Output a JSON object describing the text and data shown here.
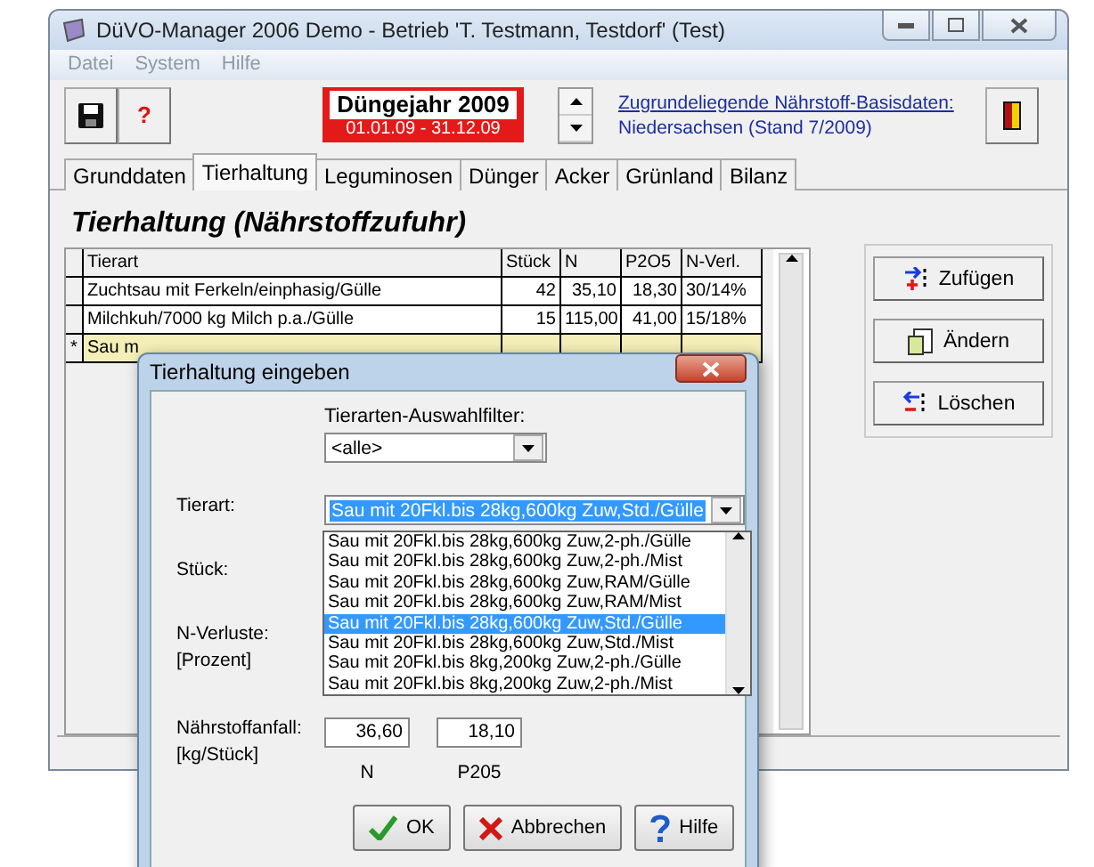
{
  "window": {
    "title": "DüVO-Manager 2006 Demo - Betrieb 'T. Testmann, Testdorf' (Test)"
  },
  "menu": [
    {
      "label": "Datei",
      "disabled": true
    },
    {
      "label": "System",
      "disabled": true
    },
    {
      "label": "Hilfe",
      "disabled": true
    }
  ],
  "toolbar": {
    "help_label": "?",
    "year_title": "Düngejahr 2009",
    "year_range": "01.01.09 - 31.12.09",
    "basis_link": "Zugrundeliegende Nährstoff-Basisdaten:",
    "basis_region": "Niedersachsen (Stand 7/2009)"
  },
  "tabs": [
    {
      "label": "Grunddaten",
      "selected": false
    },
    {
      "label": "Tierhaltung",
      "selected": true
    },
    {
      "label": "Leguminosen",
      "selected": false
    },
    {
      "label": "Dünger",
      "selected": false
    },
    {
      "label": "Acker",
      "selected": false
    },
    {
      "label": "Grünland",
      "selected": false
    },
    {
      "label": "Bilanz",
      "selected": false
    }
  ],
  "heading": "Tierhaltung (Nährstoffzufuhr)",
  "table": {
    "columns": [
      "Tierart",
      "Stück",
      "N",
      "P2O5",
      "N-Verl."
    ],
    "rows": [
      {
        "marker": "",
        "selected": false,
        "cells": [
          "Zuchtsau mit Ferkeln/einphasig/Gülle",
          "42",
          "35,10",
          "18,30",
          "30/14%"
        ]
      },
      {
        "marker": "",
        "selected": false,
        "cells": [
          "Milchkuh/7000 kg Milch p.a./Gülle",
          "15",
          "115,00",
          "41,00",
          "15/18%"
        ]
      },
      {
        "marker": "*",
        "selected": true,
        "cells": [
          "Sau m"
        ]
      }
    ]
  },
  "side_buttons": [
    {
      "kind": "add",
      "label": "Zufügen"
    },
    {
      "kind": "edit",
      "label": "Ändern"
    },
    {
      "kind": "delete",
      "label": "Löschen"
    }
  ],
  "dialog": {
    "title": "Tierhaltung eingeben",
    "filter_label": "Tierarten-Auswahlfilter:",
    "filter_value": "<alle>",
    "tierart_label": "Tierart:",
    "tierart_value": "Sau mit 20Fkl.bis 28kg,600kg Zuw,Std./Gülle",
    "options": [
      {
        "label": "Sau mit 20Fkl.bis 28kg,600kg Zuw,2-ph./Gülle",
        "selected": false
      },
      {
        "label": "Sau mit 20Fkl.bis 28kg,600kg Zuw,2-ph./Mist",
        "selected": false
      },
      {
        "label": "Sau mit 20Fkl.bis 28kg,600kg Zuw,RAM/Gülle",
        "selected": false
      },
      {
        "label": "Sau mit 20Fkl.bis 28kg,600kg Zuw,RAM/Mist",
        "selected": false
      },
      {
        "label": "Sau mit 20Fkl.bis 28kg,600kg Zuw,Std./Gülle",
        "selected": true
      },
      {
        "label": "Sau mit 20Fkl.bis 28kg,600kg Zuw,Std./Mist",
        "selected": false
      },
      {
        "label": "Sau mit 20Fkl.bis 8kg,200kg Zuw,2-ph./Gülle",
        "selected": false
      },
      {
        "label": "Sau mit 20Fkl.bis 8kg,200kg Zuw,2-ph./Mist",
        "selected": false
      }
    ],
    "stueck_label": "Stück:",
    "loss_label": "N-Verluste:",
    "loss_unit": "[Prozent]",
    "nutrient_label": "Nährstoffanfall:",
    "nutrient_unit": "[kg/Stück]",
    "nutrients": [
      {
        "value": "36,60",
        "label": "N"
      },
      {
        "value": "18,10",
        "label": "P205"
      }
    ],
    "buttons": [
      {
        "kind": "ok",
        "label": "OK"
      },
      {
        "kind": "cancel",
        "label": "Abbrechen"
      },
      {
        "kind": "help",
        "label": "Hilfe"
      }
    ]
  }
}
